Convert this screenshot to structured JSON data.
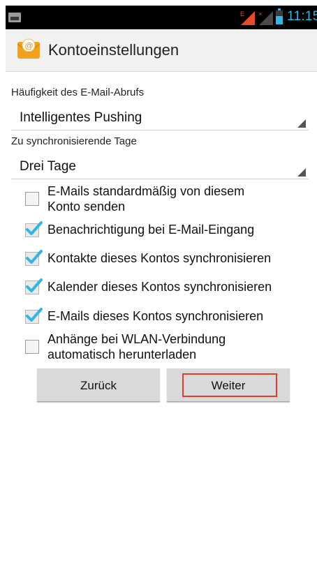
{
  "status_bar": {
    "time": "11:15",
    "network_label": "E",
    "icons": [
      "image-notification-icon",
      "signal-e-icon",
      "signal-no-data-icon",
      "battery-icon"
    ],
    "accent_color": "#33b5e5"
  },
  "action_bar": {
    "title": "Kontoeinstellungen",
    "icon": "email-app-icon"
  },
  "fetch_frequency": {
    "label": "Häufigkeit des E-Mail-Abrufs",
    "value": "Intelligentes Pushing"
  },
  "sync_days": {
    "label": "Zu synchronisierende Tage",
    "value": "Drei Tage"
  },
  "options": [
    {
      "line1": "E-Mails standardmäßig von diesem",
      "line2": "Konto senden",
      "checked": false
    },
    {
      "line1": "Benachrichtigung bei E-Mail-Eingang",
      "line2": "",
      "checked": true
    },
    {
      "line1": "Kontakte dieses Kontos synchronisieren",
      "line2": "",
      "checked": true
    },
    {
      "line1": "Kalender dieses Kontos synchronisieren",
      "line2": "",
      "checked": true
    },
    {
      "line1": "E-Mails dieses Kontos synchronisieren",
      "line2": "",
      "checked": true
    },
    {
      "line1": "Anhänge bei WLAN-Verbindung",
      "line2": "automatisch herunterladen",
      "checked": false
    }
  ],
  "buttons": {
    "back": "Zurück",
    "next": "Weiter"
  },
  "colors": {
    "check_color": "#33b5e5",
    "highlight": "#e33b2a"
  }
}
